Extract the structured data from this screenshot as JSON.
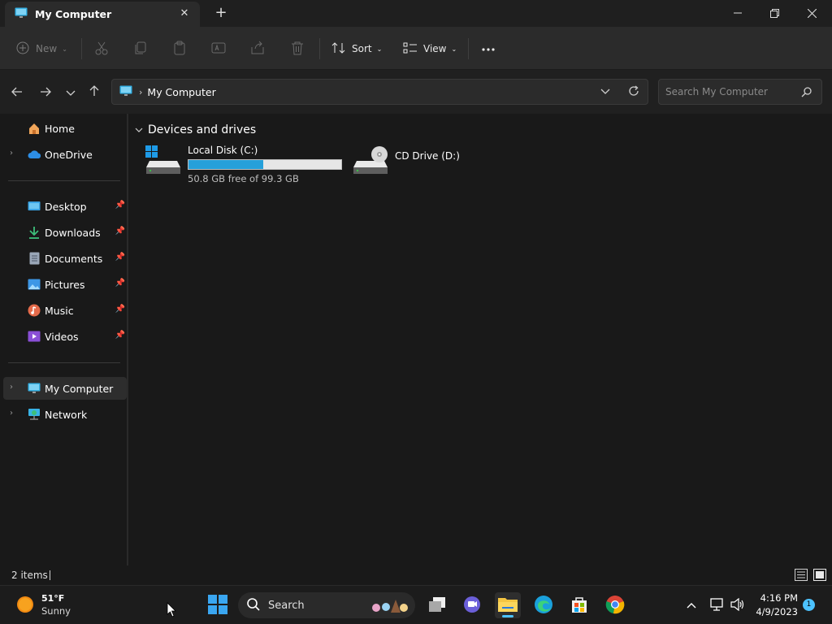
{
  "window": {
    "tab_title": "My Computer",
    "new_tab_symbol": "+"
  },
  "toolbar": {
    "new_label": "New",
    "sort_label": "Sort",
    "view_label": "View"
  },
  "address": {
    "location": "My Computer",
    "search_placeholder": "Search My Computer"
  },
  "sidebar": {
    "top": [
      {
        "label": "Home",
        "icon": "home-icon"
      },
      {
        "label": "OneDrive",
        "icon": "cloud-icon"
      }
    ],
    "pinned": [
      {
        "label": "Desktop",
        "icon": "desktop-icon"
      },
      {
        "label": "Downloads",
        "icon": "download-icon"
      },
      {
        "label": "Documents",
        "icon": "document-icon"
      },
      {
        "label": "Pictures",
        "icon": "picture-icon"
      },
      {
        "label": "Music",
        "icon": "music-icon"
      },
      {
        "label": "Videos",
        "icon": "video-icon"
      }
    ],
    "bottom": [
      {
        "label": "My Computer",
        "icon": "computer-icon",
        "selected": true
      },
      {
        "label": "Network",
        "icon": "network-icon"
      }
    ]
  },
  "content": {
    "group_title": "Devices and drives",
    "drives": [
      {
        "name": "Local Disk (C:)",
        "free_text": "50.8 GB free of 99.3 GB",
        "used_fraction": 0.488
      },
      {
        "name": "CD Drive (D:)"
      }
    ]
  },
  "status": {
    "items_text": "2 items"
  },
  "taskbar": {
    "weather_temp": "51°F",
    "weather_desc": "Sunny",
    "search_label": "Search",
    "time": "4:16 PM",
    "date": "4/9/2023",
    "notification_count": "1"
  },
  "colors": {
    "accent": "#4cc2ff",
    "progress": "#26a0da",
    "window_bg": "#191919"
  }
}
